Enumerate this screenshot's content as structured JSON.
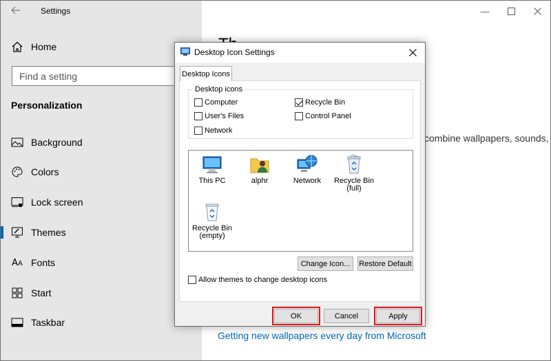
{
  "settings": {
    "title": "Settings",
    "home_label": "Home",
    "search_placeholder": "Find a setting",
    "section_title": "Personalization",
    "nav_items": [
      {
        "label": "Background",
        "icon": "picture-icon"
      },
      {
        "label": "Colors",
        "icon": "palette-icon"
      },
      {
        "label": "Lock screen",
        "icon": "monitor-lock-icon"
      },
      {
        "label": "Themes",
        "icon": "brush-icon",
        "active": true
      },
      {
        "label": "Fonts",
        "icon": "font-icon"
      },
      {
        "label": "Start",
        "icon": "start-grid-icon"
      },
      {
        "label": "Taskbar",
        "icon": "taskbar-icon"
      }
    ],
    "main_heading_fragment": "Th",
    "main_text_fragment": "combine wallpapers, sounds,",
    "main_link": "Getting new wallpapers every day from Microsoft"
  },
  "dialog": {
    "title": "Desktop Icon Settings",
    "tab_label": "Desktop Icons",
    "group_label": "Desktop icons",
    "checkboxes": [
      {
        "label": "Computer",
        "checked": false
      },
      {
        "label": "Recycle Bin",
        "checked": true
      },
      {
        "label": "User's Files",
        "checked": false
      },
      {
        "label": "Control Panel",
        "checked": false
      },
      {
        "label": "Network",
        "checked": false
      }
    ],
    "icons": [
      {
        "label": "This PC",
        "icon": "this-pc-icon"
      },
      {
        "label": "alphr",
        "icon": "user-folder-icon"
      },
      {
        "label": "Network",
        "icon": "network-icon"
      },
      {
        "label": "Recycle Bin\n(full)",
        "icon": "recycle-bin-full-icon"
      },
      {
        "label": "Recycle Bin\n(empty)",
        "icon": "recycle-bin-empty-icon"
      }
    ],
    "change_icon_label": "Change Icon...",
    "restore_default_label": "Restore Default",
    "allow_themes_label": "Allow themes to change desktop icons",
    "allow_themes_checked": false,
    "ok_label": "OK",
    "cancel_label": "Cancel",
    "apply_label": "Apply",
    "highlight_color": "#e0121b"
  }
}
